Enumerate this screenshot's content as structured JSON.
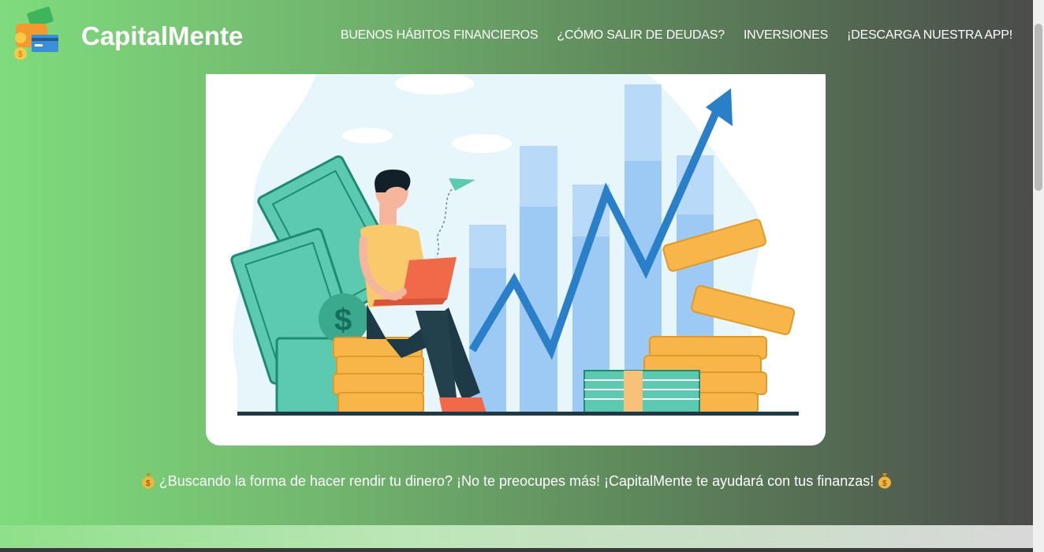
{
  "brand": {
    "name": "CapitalMente"
  },
  "nav": {
    "links": [
      {
        "label": "BUENOS HÁBITOS FINANCIEROS"
      },
      {
        "label": "¿CÓMO SALIR DE DEUDAS?"
      },
      {
        "label": "INVERSIONES"
      },
      {
        "label": "¡DESCARGA NUESTRA APP!"
      }
    ]
  },
  "hero": {
    "illustration": "person-laptop-growth-chart-money-illustration"
  },
  "tagline": {
    "text": "¿Buscando la forma de hacer rendir tu dinero? ¡No te preocupes más! ¡CapitalMente te ayudará con tus finanzas!"
  },
  "icons": {
    "bag": "money-bag-icon",
    "logo": "wallet-card-coins-icon"
  },
  "colors": {
    "brand_green": "#7fdc7c",
    "dark": "#4a4a4a",
    "chart_blue": "#2a7fc9",
    "coin": "#f7b54a",
    "money": "#5ccab0"
  }
}
